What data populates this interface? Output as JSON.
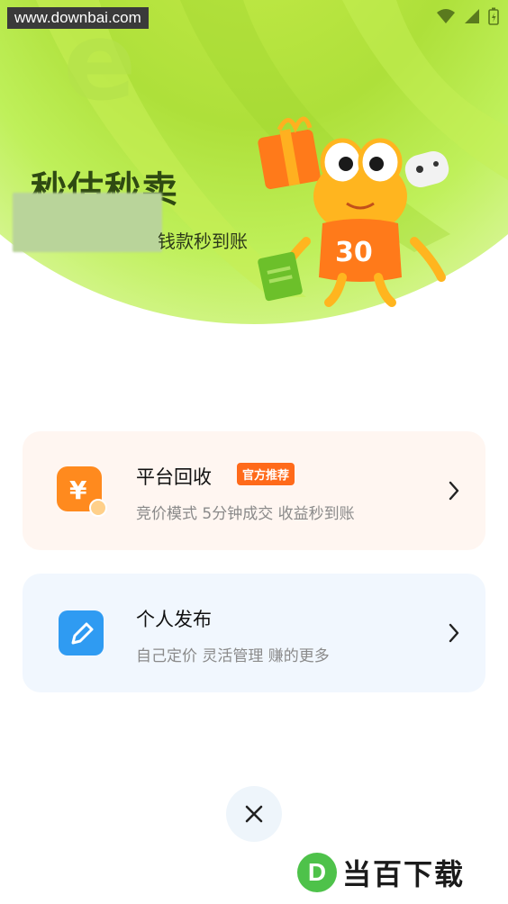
{
  "watermark": {
    "text": "www.downbai.com"
  },
  "hero": {
    "title": "秒估秒卖",
    "subtitle": "钱款秒到账",
    "mascot_number": "30"
  },
  "options": [
    {
      "title": "平台回收",
      "badge": "官方推荐",
      "description": "竞价模式 5分钟成交 收益秒到账",
      "icon": "yen-icon"
    },
    {
      "title": "个人发布",
      "description": "自己定价 灵活管理 赚的更多",
      "icon": "pencil-icon"
    }
  ],
  "close": {
    "icon": "close-icon"
  },
  "brand": {
    "logo_letter": "D",
    "text": "当百下载"
  },
  "colors": {
    "accent_orange": "#ff6a1a",
    "recycle_card_bg": "#fff6f1",
    "publish_card_bg": "#f1f7fe",
    "hero_green": "#aee03a"
  }
}
